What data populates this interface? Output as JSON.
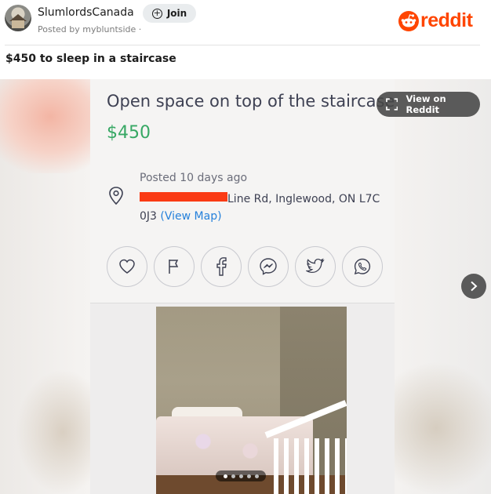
{
  "header": {
    "community": "SlumlordsCanada",
    "join_label": "Join",
    "posted_by": "Posted by mybluntside ·",
    "brand": "reddit"
  },
  "post": {
    "title": "$450 to sleep in a staircase"
  },
  "listing": {
    "title": "Open space on top of the staircase",
    "price": "$450",
    "posted": "Posted 10 days ago",
    "address_rest": "Line Rd, Inglewood, ON L7C 0J3",
    "map_link": "(View Map)",
    "share_icons": [
      "heart-icon",
      "flag-icon",
      "facebook-icon",
      "messenger-icon",
      "twitter-icon",
      "whatsapp-icon"
    ]
  },
  "media": {
    "view_on_reddit_label": "View on Reddit",
    "gallery_dots": 5,
    "active_dot": 1
  },
  "colors": {
    "reddit_orange": "#ff4500",
    "price_green": "#37a864",
    "link_blue": "#2681db",
    "redaction_red": "#fa3a14"
  }
}
